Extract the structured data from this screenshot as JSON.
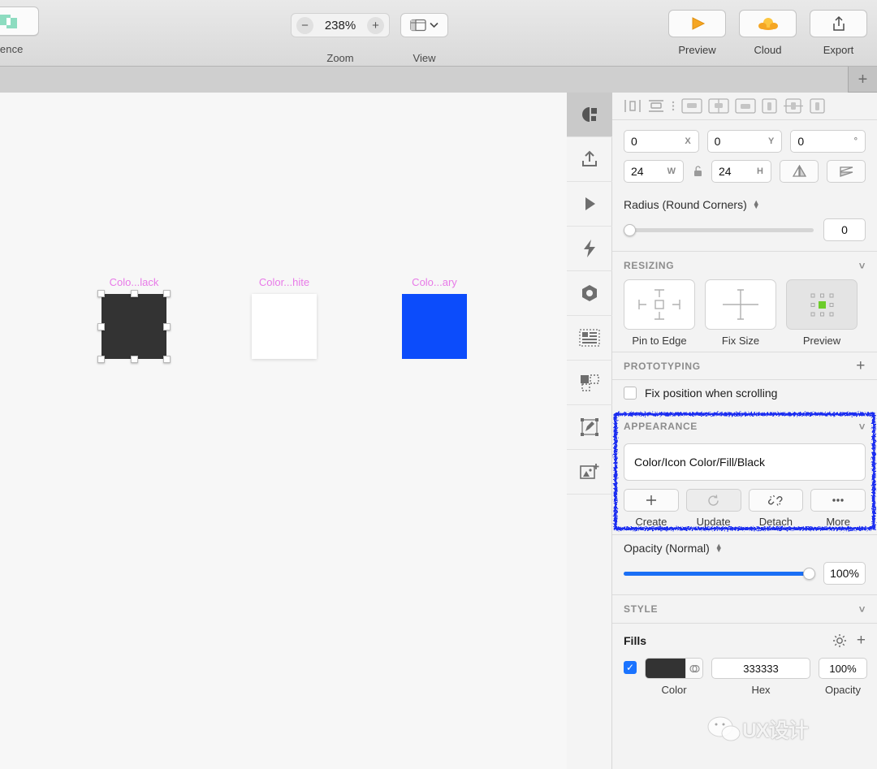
{
  "toolbar": {
    "difference_label": "rence",
    "zoom": {
      "value": "238%",
      "label": "Zoom",
      "minus": "−",
      "plus": "+"
    },
    "view": {
      "label": "View"
    },
    "right_tools": [
      {
        "name": "preview",
        "label": "Preview"
      },
      {
        "name": "cloud",
        "label": "Cloud"
      },
      {
        "name": "export",
        "label": "Export"
      }
    ]
  },
  "tabbar": {
    "new_tab": "+"
  },
  "canvas": {
    "artboards": [
      {
        "label": "Colo...lack",
        "color": "#333333",
        "selected": true
      },
      {
        "label": "Color...hite",
        "color": "#ffffff",
        "selected": false
      },
      {
        "label": "Colo...ary",
        "color": "#0c4cfb",
        "selected": false
      }
    ],
    "label_color": "#e87ae8"
  },
  "rail": {
    "items": [
      {
        "name": "inspector",
        "active": true
      },
      {
        "name": "export-panel",
        "active": false
      },
      {
        "name": "prototype-play",
        "active": false
      },
      {
        "name": "interactions-bolt",
        "active": false
      },
      {
        "name": "components-hexagon",
        "active": false
      },
      {
        "name": "layout-grid",
        "active": false
      },
      {
        "name": "symbols",
        "active": false
      },
      {
        "name": "pen-edit",
        "active": false
      },
      {
        "name": "add-image",
        "active": false
      }
    ]
  },
  "inspector": {
    "geometry": {
      "x": {
        "value": "0",
        "unit": "X"
      },
      "y": {
        "value": "0",
        "unit": "Y"
      },
      "rotation": {
        "value": "0",
        "unit": "°"
      },
      "w": {
        "value": "24",
        "unit": "W"
      },
      "h": {
        "value": "24",
        "unit": "H"
      },
      "lock": "unlocked"
    },
    "radius": {
      "title": "Radius (Round Corners)",
      "value": "0",
      "slider_pct": 0
    },
    "resizing": {
      "title": "RESIZING",
      "options": [
        {
          "label": "Pin to Edge",
          "selected": false
        },
        {
          "label": "Fix Size",
          "selected": false
        },
        {
          "label": "Preview",
          "selected": true
        }
      ]
    },
    "prototyping": {
      "title": "PROTOTYPING",
      "checkbox_label": "Fix position when scrolling",
      "checked": false
    },
    "appearance": {
      "title": "APPEARANCE",
      "name_value": "Color/Icon Color/Fill/Black",
      "actions": [
        {
          "label": "Create",
          "icon": "plus-icon",
          "disabled": false
        },
        {
          "label": "Update",
          "icon": "refresh-icon",
          "disabled": true
        },
        {
          "label": "Detach",
          "icon": "broken-link-icon",
          "disabled": false
        },
        {
          "label": "More",
          "icon": "ellipsis-icon",
          "disabled": false
        }
      ],
      "highlighted": true,
      "highlight_color": "#1d2ff0"
    },
    "opacity": {
      "title": "Opacity (Normal)",
      "value": "100%",
      "slider_pct": 100,
      "accent": "#1a6ff5"
    },
    "style": {
      "title": "STYLE"
    },
    "fills": {
      "title": "Fills",
      "rows": [
        {
          "enabled": true,
          "color": "#333333",
          "hex": "333333",
          "opacity": "100%",
          "captions": {
            "color": "Color",
            "hex": "Hex",
            "opacity": "Opacity"
          }
        }
      ]
    }
  },
  "watermark": {
    "text": "UX设计"
  }
}
